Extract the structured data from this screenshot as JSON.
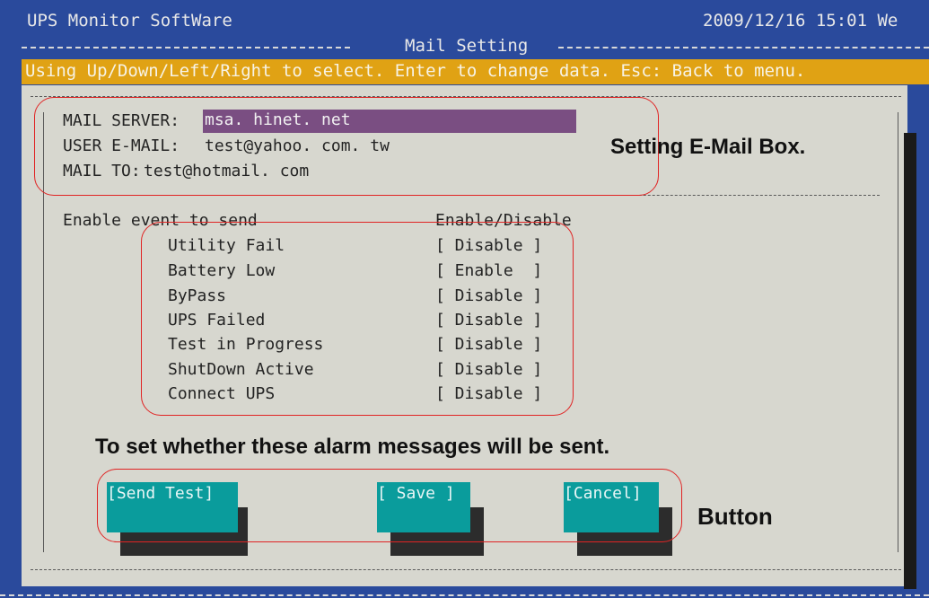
{
  "app_title": "UPS Monitor SoftWare",
  "datetime": "2009/12/16 15:01 We",
  "screen_title": "Mail Setting",
  "status_hint": "Using Up/Down/Left/Right to select. Enter to change data. Esc: Back to menu.",
  "mail": {
    "server_label": "MAIL SERVER:",
    "server_value": "msa. hinet. net",
    "user_label": "USER E-MAIL:",
    "user_value": "test@yahoo. com. tw",
    "to_label": "MAIL TO:",
    "to_value": "test@hotmail. com"
  },
  "events": {
    "header_left": "Enable event to send",
    "header_right": "Enable/Disable",
    "items": [
      {
        "label": "Utility Fail",
        "state": "[ Disable ]"
      },
      {
        "label": "Battery Low",
        "state": "[ Enable  ]"
      },
      {
        "label": "ByPass",
        "state": "[ Disable ]"
      },
      {
        "label": "UPS Failed",
        "state": "[ Disable ]"
      },
      {
        "label": "Test in Progress",
        "state": "[ Disable ]"
      },
      {
        "label": "ShutDown Active",
        "state": "[ Disable ]"
      },
      {
        "label": "Connect UPS",
        "state": "[ Disable ]"
      }
    ]
  },
  "buttons": {
    "send_test": "[Send Test]",
    "save": "[ Save ]",
    "cancel": "[Cancel]"
  },
  "annotations": {
    "mailbox": "Setting E-Mail Box.",
    "alarms": "To set whether these alarm messages will be sent.",
    "button": "Button"
  },
  "colors": {
    "background": "#2a4a9c",
    "status_bar": "#e0a214",
    "panel": "#d7d7cf",
    "selected_field": "#7a4e82",
    "button": "#0a9c9c",
    "callout": "#e02424"
  }
}
